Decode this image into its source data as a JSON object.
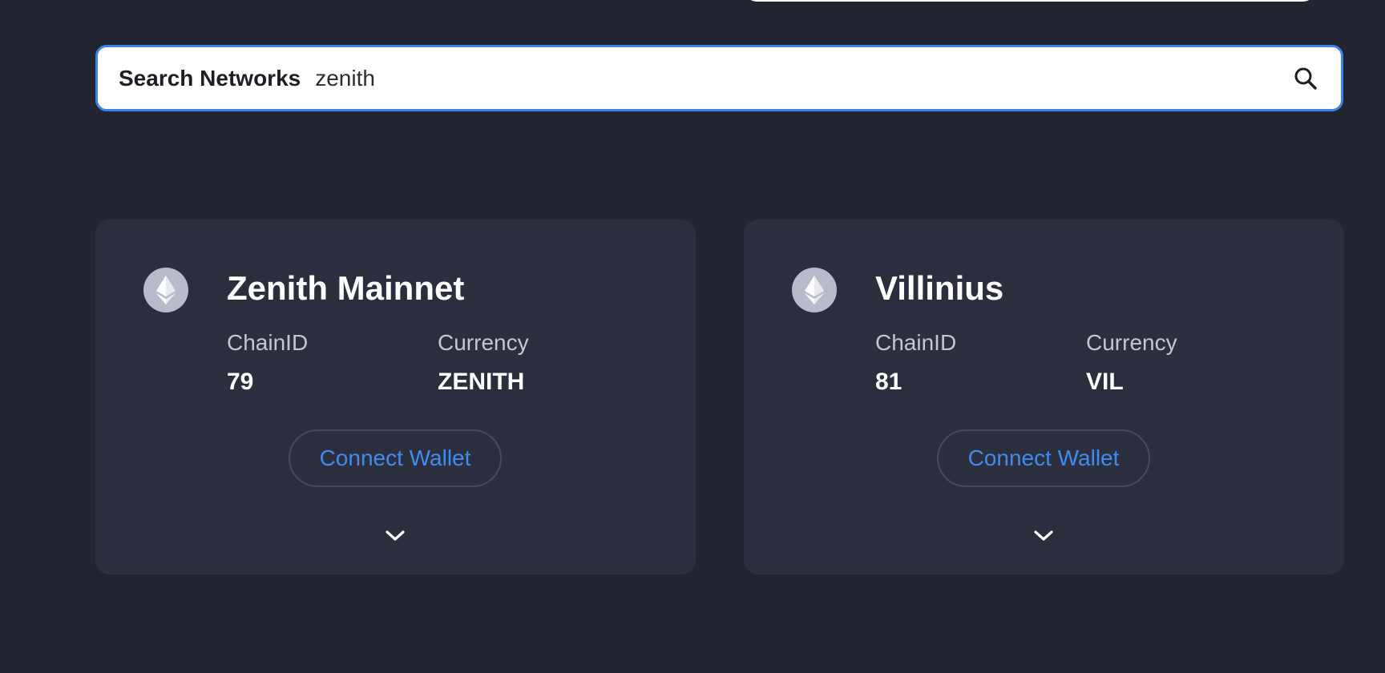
{
  "search": {
    "label": "Search Networks",
    "value": "zenith",
    "icon": "search-icon"
  },
  "colors": {
    "background": "#22252f",
    "card": "#2b2e3c",
    "accent": "#3f8cf0",
    "focus_border": "#3a86e8"
  },
  "networks": [
    {
      "name": "Zenith Mainnet",
      "icon": "ethereum-icon",
      "chain_id_label": "ChainID",
      "chain_id": "79",
      "currency_label": "Currency",
      "currency": "ZENITH",
      "connect_label": "Connect Wallet",
      "expand_icon": "chevron-down-icon"
    },
    {
      "name": "Villinius",
      "icon": "ethereum-icon",
      "chain_id_label": "ChainID",
      "chain_id": "81",
      "currency_label": "Currency",
      "currency": "VIL",
      "connect_label": "Connect Wallet",
      "expand_icon": "chevron-down-icon"
    }
  ]
}
